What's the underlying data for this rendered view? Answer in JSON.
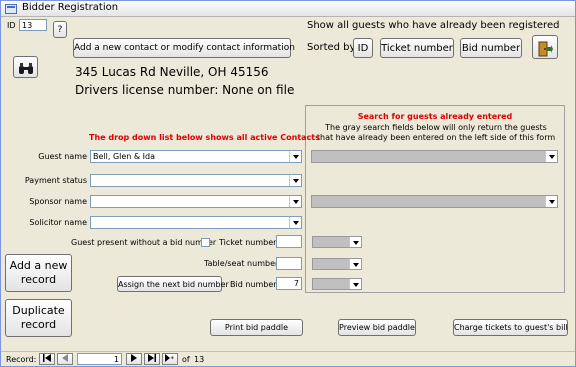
{
  "window": {
    "title": "Bidder Registration"
  },
  "id_field": {
    "label": "ID",
    "value": "13"
  },
  "help_button": {
    "label": "?"
  },
  "contact_button": {
    "label": "Add a new contact or modify contact information"
  },
  "address": {
    "line": "345 Lucas Rd     Neville, OH  45156",
    "license": "Drivers license number: None on file"
  },
  "show_all": {
    "label": "Show all guests who have already been registered"
  },
  "sorted_by": {
    "label": "Sorted by",
    "id_button": "ID",
    "ticket_button": "Ticket number",
    "bid_button": "Bid number"
  },
  "search_panel": {
    "heading": "Search for guests already entered",
    "desc": "The gray search fields below will only return the guests that have already been entered on the left side of this form"
  },
  "dropdown_note": "The drop down list below shows all active Contacts",
  "form": {
    "guest_name_label": "Guest name",
    "guest_name_value": "Bell, Glen & Ida",
    "payment_status_label": "Payment status",
    "sponsor_name_label": "Sponsor name",
    "solicitor_name_label": "Solicitor name",
    "no_bid_label": "Guest present without a bid number",
    "ticket_number_label": "Ticket  number",
    "table_seat_label": "Table/seat number",
    "bid_number_label": "Bid  number",
    "bid_number_value": "7"
  },
  "buttons": {
    "add_record": "Add a new record",
    "duplicate_record": "Duplicate record",
    "assign_bid": "Assign the next bid number",
    "print_paddle": "Print bid paddle",
    "preview_paddle": "Preview bid paddle",
    "charge_tickets": "Charge tickets to guest's bill"
  },
  "record_nav": {
    "label": "Record:",
    "current": "1",
    "of_label": "of",
    "total": "13"
  },
  "colors": {
    "note_red": "#e00000",
    "search_gray": "#c0c0c0"
  },
  "icons": {
    "search": "binoculars-icon",
    "exit": "exit-door-icon"
  }
}
